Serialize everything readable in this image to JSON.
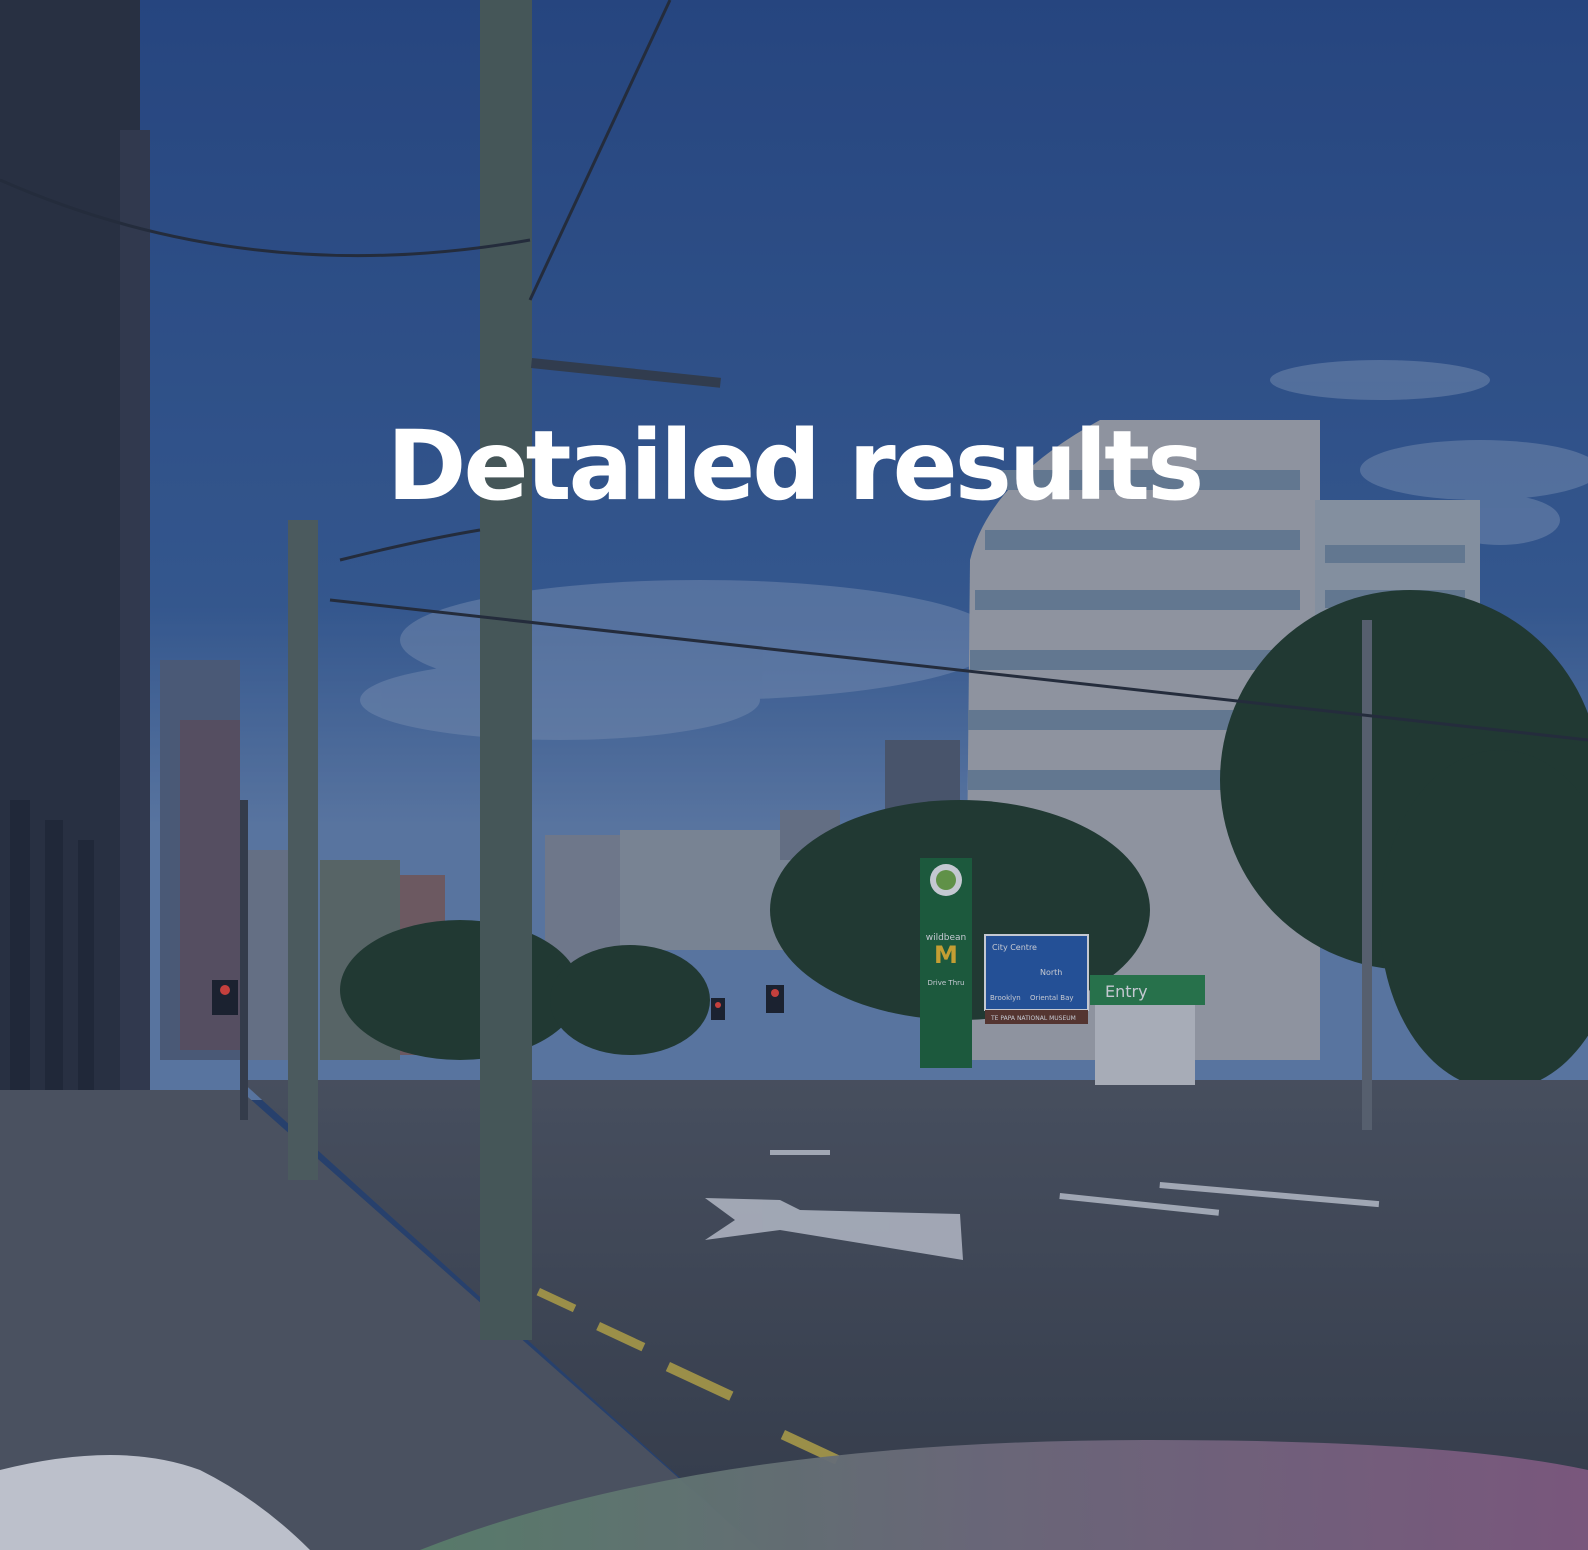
{
  "hero": {
    "title": "Detailed results"
  },
  "scene": {
    "signs": {
      "wildbean": "wildbean",
      "drive_thru": "Drive Thru",
      "entry": "Entry",
      "city_centre": "City Centre",
      "north": "North",
      "brooklyn": "Brooklyn",
      "oriental_bay": "Oriental Bay",
      "te_papa": "TE PAPA NATIONAL MUSEUM"
    }
  },
  "colors": {
    "sky": "#2f5696",
    "sky_light": "#5a7fb5",
    "road": "#4a4f58",
    "pavement": "#5b5f66",
    "tree": "#27402f",
    "bp_green": "#1f7a3e",
    "sign_blue": "#2a5fb0",
    "title": "#ffffff",
    "wave_left": "#ffffff",
    "wave_right": "#9b6a8f",
    "wave_green": "#7fa583"
  }
}
